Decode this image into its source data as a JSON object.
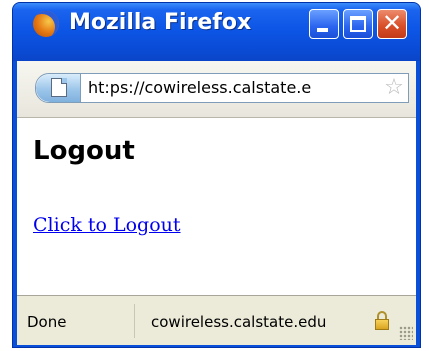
{
  "window": {
    "title": "Mozilla Firefox",
    "controls": {
      "minimize": "minimize",
      "maximize": "maximize",
      "close": "✕"
    }
  },
  "url_bar": {
    "url": "ht:ps://cowireless.calstate.e",
    "site_icon": "page-icon",
    "bookmark_icon": "star-icon"
  },
  "page": {
    "heading": "Logout",
    "link_text": "Click to Logout"
  },
  "status_bar": {
    "status": "Done",
    "host": "cowireless.calstate.edu",
    "security_icon": "lock-icon"
  },
  "colors": {
    "titlebar": "#0a4fd8",
    "close_button": "#d9502a",
    "link": "#0000ee",
    "statusbar": "#ecead8"
  }
}
